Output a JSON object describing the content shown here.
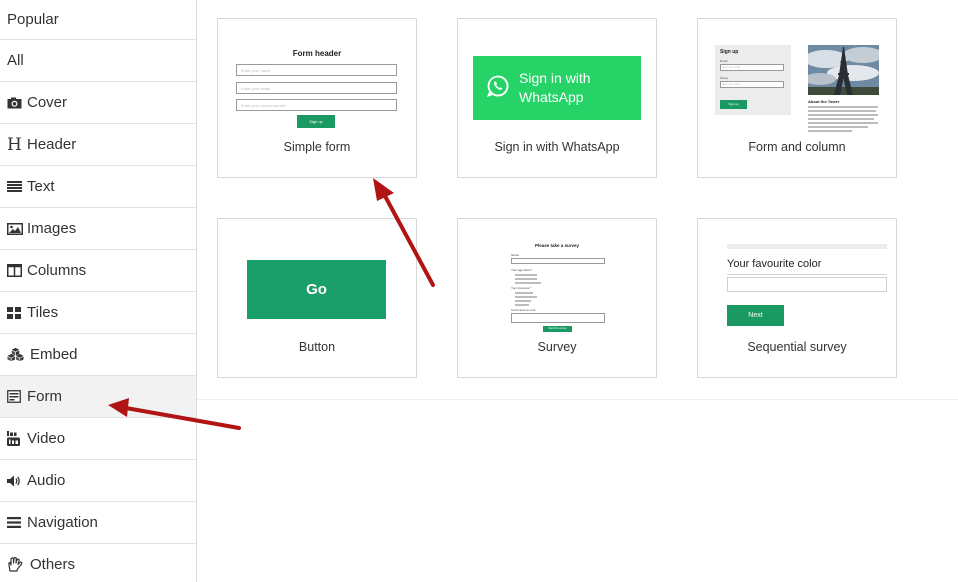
{
  "sidebar": {
    "items": [
      {
        "label": "Popular",
        "icon": ""
      },
      {
        "label": "All",
        "icon": ""
      },
      {
        "label": "Cover",
        "icon": "camera-icon"
      },
      {
        "label": "Header",
        "icon": "header-icon"
      },
      {
        "label": "Text",
        "icon": "text-lines-icon"
      },
      {
        "label": "Images",
        "icon": "image-icon"
      },
      {
        "label": "Columns",
        "icon": "columns-icon"
      },
      {
        "label": "Tiles",
        "icon": "tiles-icon"
      },
      {
        "label": "Embed",
        "icon": "cubes-icon"
      },
      {
        "label": "Form",
        "icon": "form-icon"
      },
      {
        "label": "Video",
        "icon": "youtube-icon"
      },
      {
        "label": "Audio",
        "icon": "speaker-icon"
      },
      {
        "label": "Navigation",
        "icon": "hamburger-icon"
      },
      {
        "label": "Others",
        "icon": "hand-icon"
      }
    ],
    "header_glyph": "H",
    "active_index": 9
  },
  "templates": [
    {
      "caption": "Simple form",
      "thumb": {
        "title": "Form header",
        "fields": [
          "Enter your name",
          "Enter your email",
          "Enter your phone number"
        ],
        "button": "Sign up"
      }
    },
    {
      "caption": "Sign in with WhatsApp",
      "thumb": {
        "text_line1": "Sign in with",
        "text_line2": "WhatsApp"
      }
    },
    {
      "caption": "Form and column",
      "thumb": {
        "title": "Sign up",
        "email_label": "Email",
        "email_placeholder": "Enter your email",
        "name_label": "Name",
        "name_placeholder": "Enter your name",
        "button": "Sign up",
        "about": "About the Tower"
      }
    },
    {
      "caption": "Button",
      "thumb": {
        "button": "Go"
      }
    },
    {
      "caption": "Survey",
      "thumb": {
        "title": "Please take a survey",
        "name_label": "Name",
        "q1": "Your age band *",
        "q2": "Your interests *",
        "comments": "Comments to note",
        "button": "Send the survey"
      }
    },
    {
      "caption": "Sequential survey",
      "thumb": {
        "question": "Your favourite color",
        "button": "Next"
      }
    }
  ],
  "colors": {
    "brand_green": "#1a9a62",
    "whatsapp_green": "#25d366",
    "arrow_red": "#b01414"
  }
}
